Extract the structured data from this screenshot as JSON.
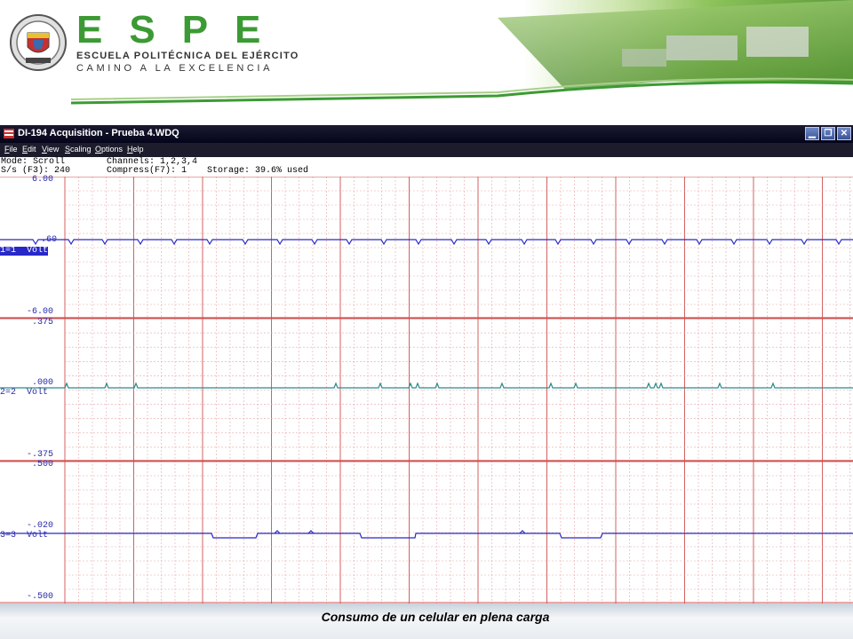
{
  "banner": {
    "brand": "ESPE",
    "subtitle1": "ESCUELA POLITÉCNICA DEL EJÉRCITO",
    "subtitle2": "CAMINO A LA EXCELENCIA",
    "colors": {
      "brand_green": "#3c9a34",
      "accent_green": "#5aa83a"
    }
  },
  "window": {
    "title": "DI-194 Acquisition - Prueba 4.WDQ",
    "buttons": {
      "minimize": "▁",
      "restore": "❐",
      "close": "✕"
    }
  },
  "menu": {
    "items": [
      "File",
      "Edit",
      "View",
      "Scaling",
      "Options",
      "Help"
    ]
  },
  "status": {
    "mode": "Mode: Scroll",
    "rate": "S/s (F3): 240",
    "channels": "Channels: 1,2,3,4",
    "compress": "Compress(F7): 1",
    "storage": "Storage: 39.6% used"
  },
  "channels": [
    {
      "label": "1=1  Volt",
      "top": "6.00",
      "center": ".60",
      "bottom": "-6.00",
      "active": true,
      "color": "#2828c8"
    },
    {
      "label": "2=2  Volt",
      "top": ".375",
      "center": ".000",
      "bottom": "-.375",
      "active": false,
      "color": "#2c8a8a"
    },
    {
      "label": "3=3  Volt",
      "top": ".500",
      "center": "-.020",
      "bottom": "-.500",
      "active": false,
      "color": "#2828c8"
    }
  ],
  "caption": "Consumo de un celular en plena carga",
  "colors": {
    "grid": "#e8a8a8",
    "grid_major": "#d05050",
    "trace1": "#2828c8",
    "trace2": "#2c8a8a",
    "trace3": "#2828c8"
  }
}
